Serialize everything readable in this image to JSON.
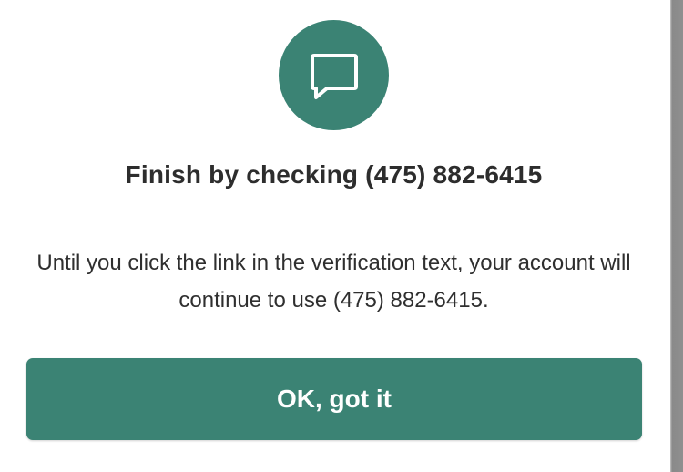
{
  "dialog": {
    "icon": "message-bubble-icon",
    "title": "Finish by checking (475) 882-6415",
    "body": "Until you click the link in the verification text, your account will continue to use (475) 882-6415.",
    "primary_button": "OK, got it"
  },
  "colors": {
    "accent": "#3b8374",
    "text": "#2d2d2d",
    "background": "#ffffff"
  }
}
